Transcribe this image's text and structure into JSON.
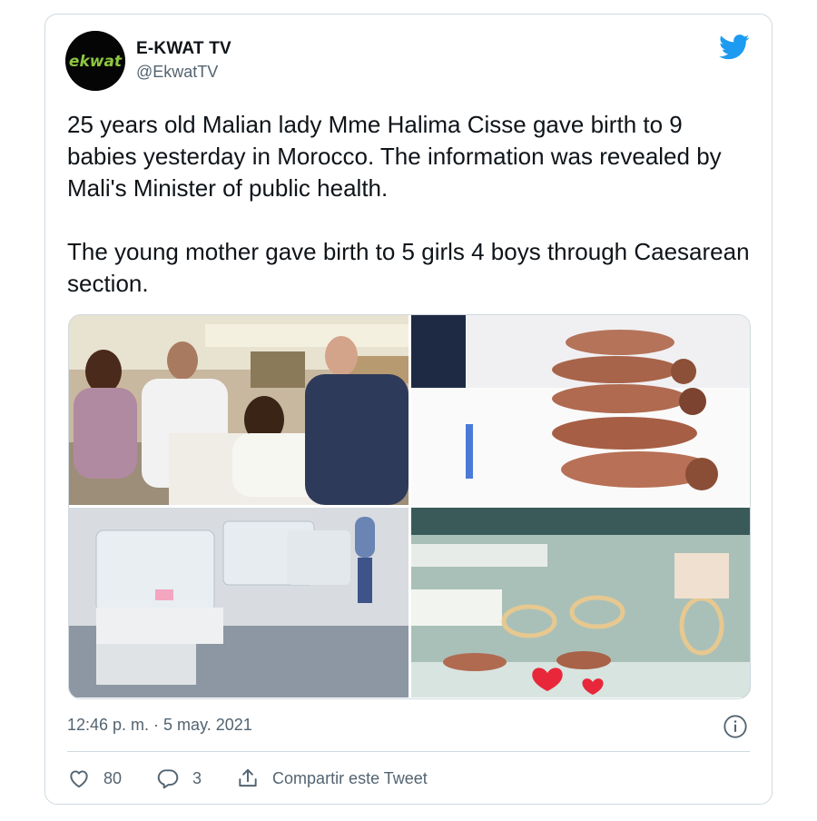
{
  "author": {
    "logo_text": "ekwat",
    "display_name": "E-KWAT TV",
    "handle": "@EkwatTV"
  },
  "tweet": {
    "paragraphs": [
      "25 years old Malian lady Mme Halima Cisse gave birth to 9 babies yesterday in Morocco. The information was revealed by Mali's Minister of public health.",
      "The young mother gave birth to 5 girls 4 boys through Caesarean section."
    ]
  },
  "media": {
    "count": 4
  },
  "meta": {
    "timestamp": "12:46 p. m. · 5 may. 2021"
  },
  "actions": {
    "likes": "80",
    "replies": "3",
    "share_label": "Compartir este Tweet"
  },
  "icons": [
    "twitter-bird-icon",
    "info-icon",
    "heart-icon",
    "reply-icon",
    "share-icon"
  ],
  "colors": {
    "twitter_blue": "#1d9bf0",
    "text": "#0f1419",
    "secondary_text": "#536471",
    "border": "#cfd9de",
    "logo_green": "#8dc63f"
  }
}
